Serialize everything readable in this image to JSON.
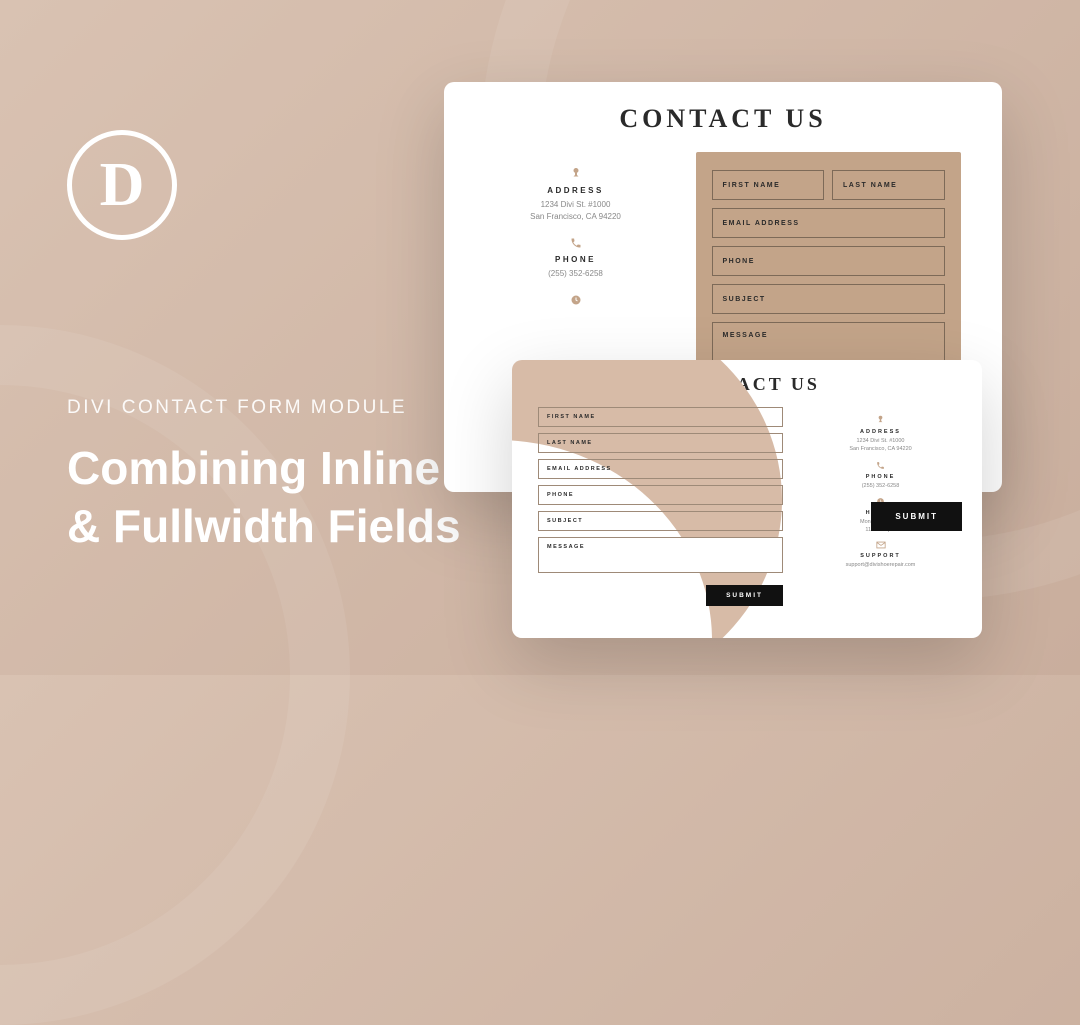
{
  "logo": "D",
  "kicker": "DIVI CONTACT FORM MODULE",
  "headline_line1": "Combining Inline",
  "headline_line2": "& Fullwidth Fields",
  "cardA": {
    "title": "CONTACT US",
    "address_label": "ADDRESS",
    "address_line1": "1234 Divi St. #1000",
    "address_line2": "San Francisco, CA 94220",
    "phone_label": "PHONE",
    "phone_value": "(255) 352-6258",
    "fields": {
      "first_name": "FIRST NAME",
      "last_name": "LAST NAME",
      "email": "EMAIL ADDRESS",
      "phone": "PHONE",
      "subject": "SUBJECT",
      "message": "MESSAGE"
    },
    "submit": "SUBMIT"
  },
  "cardB": {
    "title": "CONTACT US",
    "fields": {
      "first_name": "FIRST NAME",
      "last_name": "LAST NAME",
      "email": "EMAIL ADDRESS",
      "phone": "PHONE",
      "subject": "SUBJECT",
      "message": "MESSAGE"
    },
    "submit": "SUBMIT",
    "address_label": "ADDRESS",
    "address_line1": "1234 Divi St. #1000",
    "address_line2": "San Francisco, CA 94220",
    "phone_label": "PHONE",
    "phone_value": "(255) 352-6258",
    "hours_label": "HOURS",
    "hours_line1": "Monday – Friday",
    "hours_line2": "11am – 9pm",
    "support_label": "SUPPORT",
    "support_value": "support@divishoerepair.com"
  }
}
